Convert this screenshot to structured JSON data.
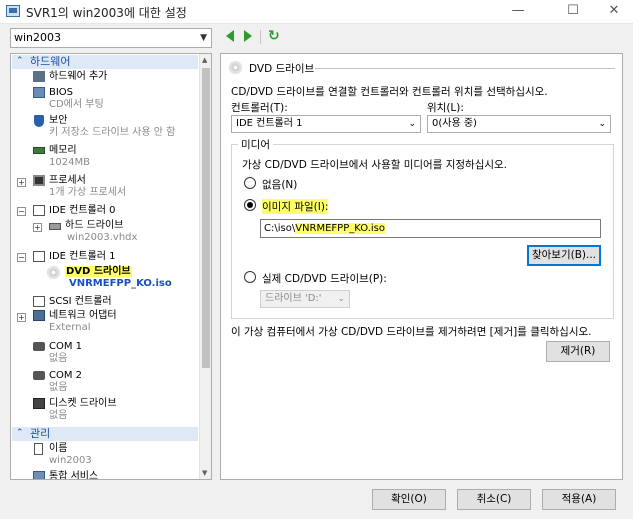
{
  "window": {
    "title": "SVR1의 win2003에 대한 설정",
    "minimize": "—",
    "maximize": "☐",
    "close": "✕"
  },
  "vm_selector": {
    "value": "win2003"
  },
  "tree": {
    "hardware_header": "하드웨어",
    "management_header": "관리",
    "items": {
      "add_hardware": {
        "label": "하드웨어 추가"
      },
      "bios": {
        "label": "BIOS",
        "sub": "CD에서 부팅"
      },
      "security": {
        "label": "보안",
        "sub": "키 저장소 드라이브 사용 안 함"
      },
      "memory": {
        "label": "메모리",
        "sub": "1024MB"
      },
      "processor": {
        "label": "프로세서",
        "sub": "1개 가상 프로세서"
      },
      "ide0": {
        "label": "IDE 컨트롤러 0"
      },
      "harddrive": {
        "label": "하드 드라이브",
        "sub": "win2003.vhdx"
      },
      "ide1": {
        "label": "IDE 컨트롤러 1"
      },
      "dvd": {
        "label": "DVD 드라이브",
        "sub": "VNRMEFPP_KO.iso"
      },
      "scsi": {
        "label": "SCSI 컨트롤러"
      },
      "nic": {
        "label": "네트워크 어댑터",
        "sub": "External"
      },
      "com1": {
        "label": "COM 1",
        "sub": "없음"
      },
      "com2": {
        "label": "COM 2",
        "sub": "없음"
      },
      "floppy": {
        "label": "디스켓 드라이브",
        "sub": "없음"
      },
      "name": {
        "label": "이름",
        "sub": "win2003"
      },
      "integration": {
        "label": "통합 서비스"
      }
    }
  },
  "panel": {
    "heading": "DVD 드라이브",
    "description": "CD/DVD 드라이브를 연결할 컨트롤러와 컨트롤러 위치를 선택하십시오.",
    "controller_label": "컨트롤러(T):",
    "controller_value": "IDE 컨트롤러 1",
    "location_label": "위치(L):",
    "location_value": "0(사용 중)",
    "media_legend": "미디어",
    "media_description": "가상 CD/DVD 드라이브에서 사용할 미디어를 지정하십시오.",
    "none_label": "없음(N)",
    "image_file_label": "이미지 파일(I):",
    "image_path_prefix": "C:\\iso\\",
    "image_path_file": "VNRMEFPP_KO.iso",
    "browse_button": "찾아보기(B)...",
    "physical_label": "실제 CD/DVD 드라이브(P):",
    "physical_value": "드라이브 'D:'",
    "remove_description": "이 가상 컴퓨터에서 가상 CD/DVD 드라이브를 제거하려면 [제거]를 클릭하십시오.",
    "remove_button": "제거(R)"
  },
  "footer": {
    "ok": "확인(O)",
    "cancel": "취소(C)",
    "apply": "적용(A)"
  }
}
